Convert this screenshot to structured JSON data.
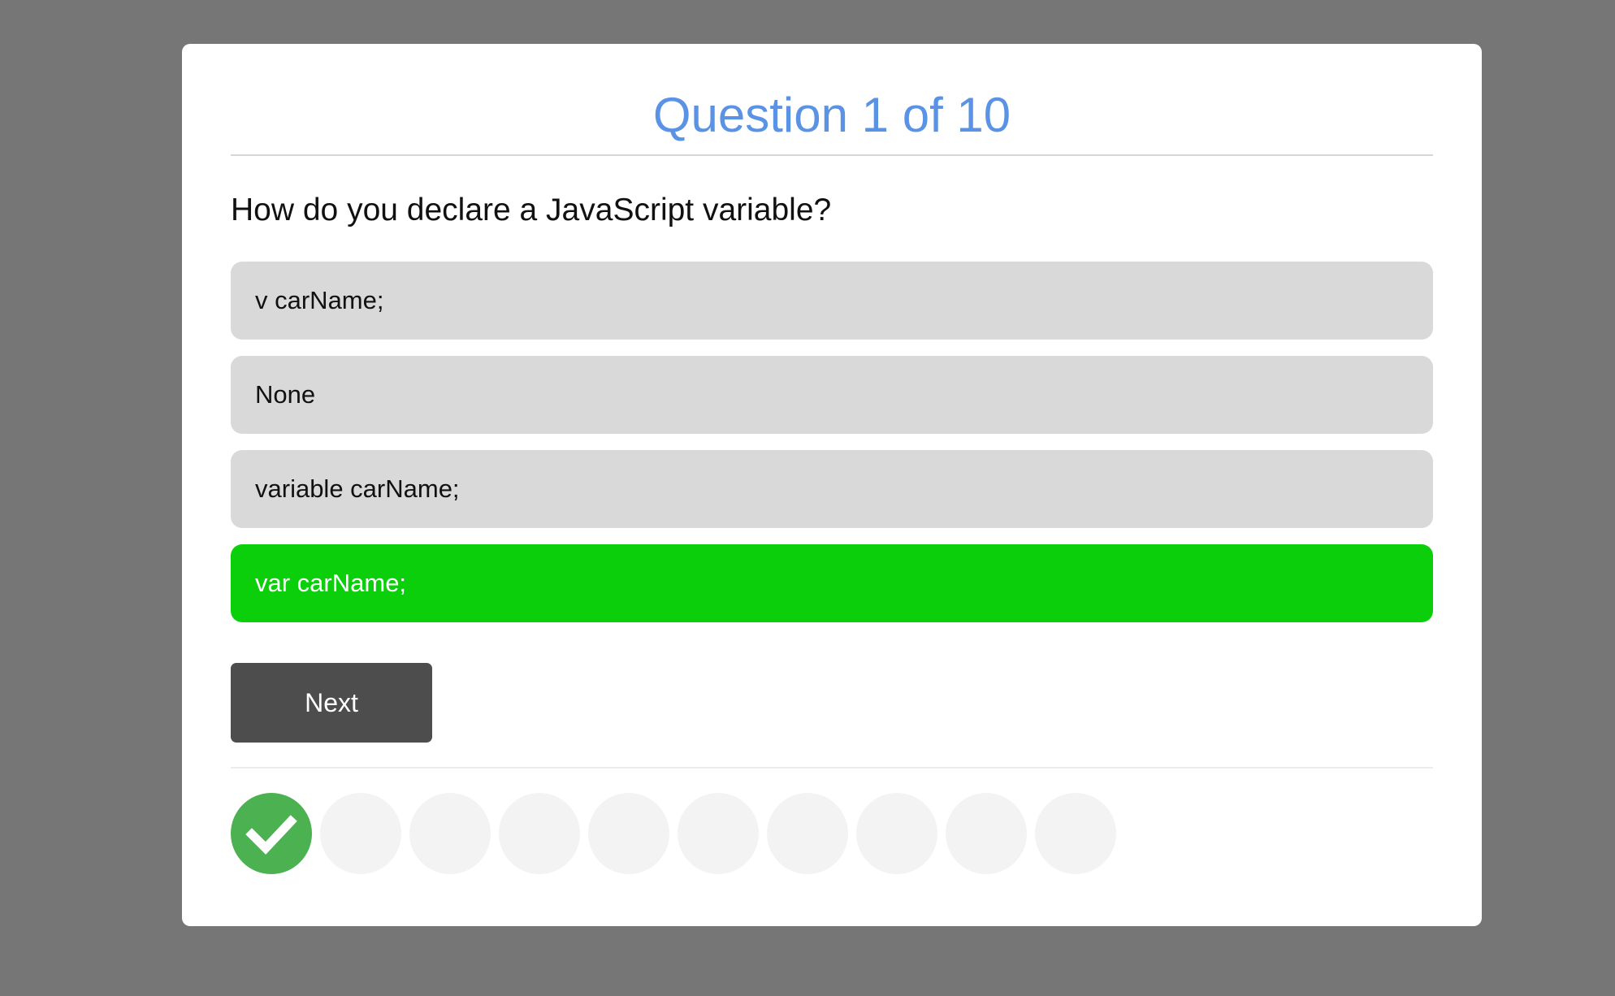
{
  "quiz": {
    "title": "Question 1 of 10",
    "question": "How do you declare a JavaScript variable?",
    "options": [
      {
        "label": "v carName;",
        "state": "neutral"
      },
      {
        "label": "None",
        "state": "neutral"
      },
      {
        "label": "variable carName;",
        "state": "neutral"
      },
      {
        "label": "var carName;",
        "state": "correct"
      }
    ],
    "next_label": "Next"
  },
  "progress": {
    "total": 10,
    "answered": 1,
    "status": [
      "correct",
      "pending",
      "pending",
      "pending",
      "pending",
      "pending",
      "pending",
      "pending",
      "pending",
      "pending"
    ],
    "done_icon": "checkmark-icon"
  },
  "colors": {
    "background": "#767676",
    "card": "#ffffff",
    "title": "#5b93e4",
    "option_neutral": "#d9d9d9",
    "option_correct": "#0acf0a",
    "next_button": "#4d4d4d",
    "dot_done": "#4cb151",
    "dot_pending": "#f3f3f3"
  }
}
